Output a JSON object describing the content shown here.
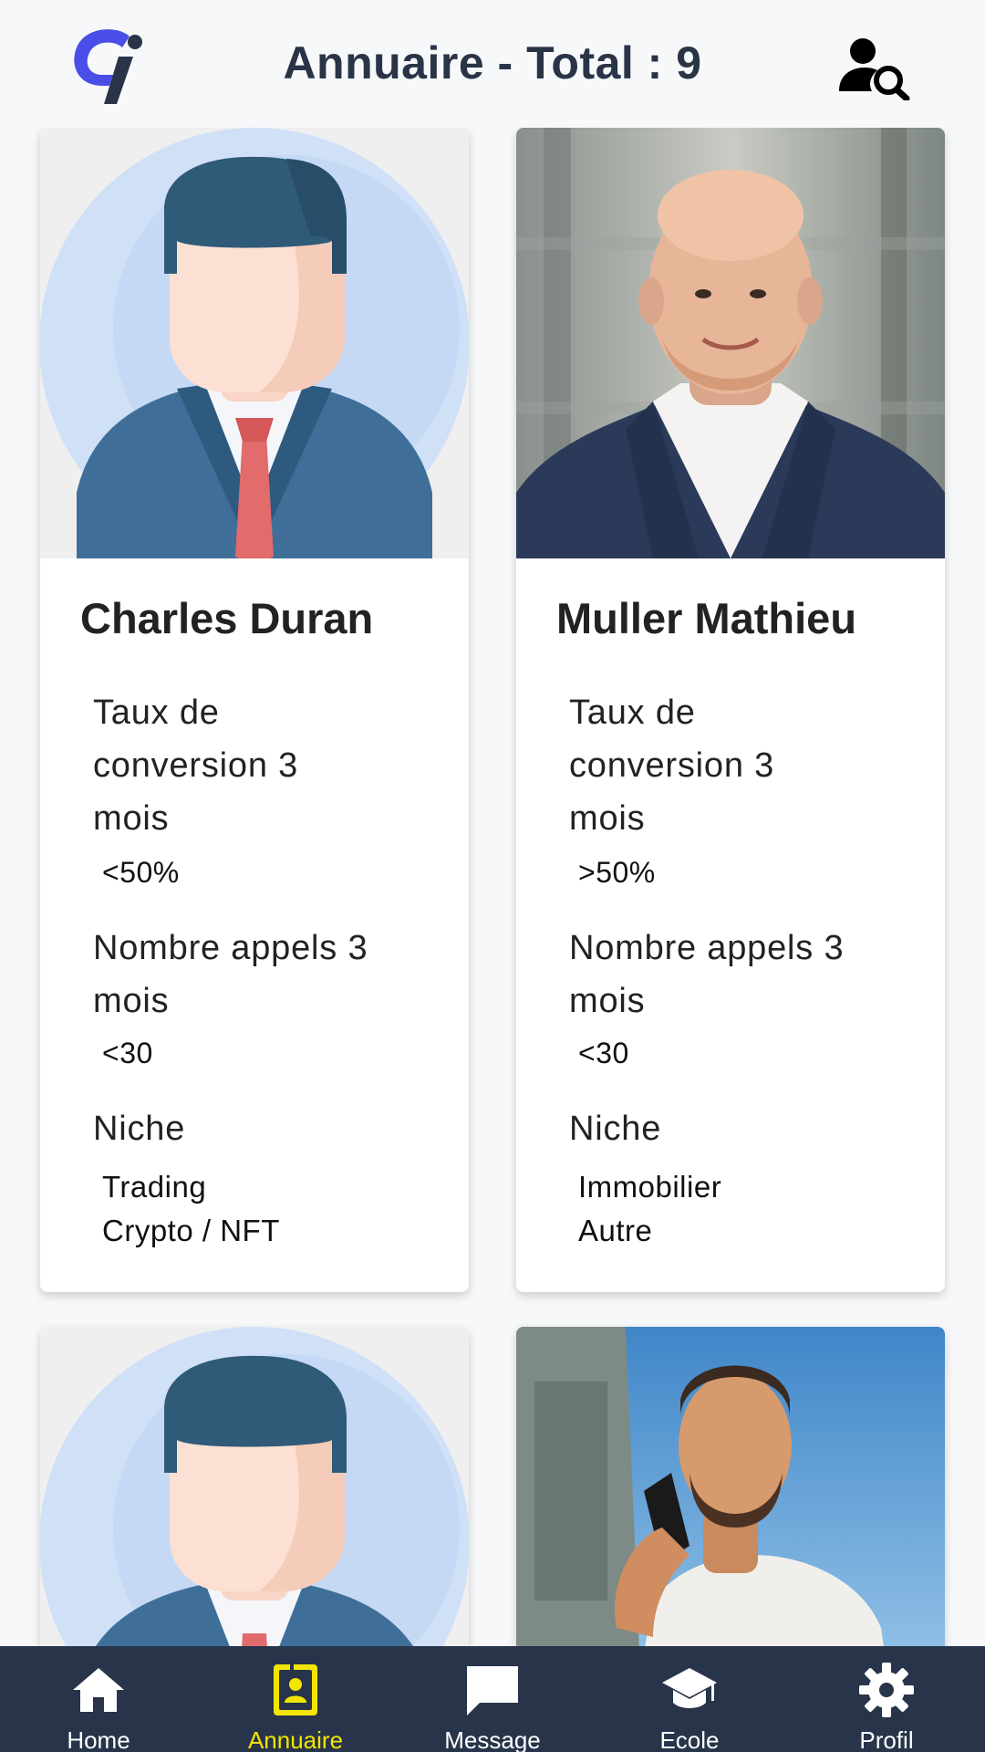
{
  "header": {
    "title": "Annuaire - Total : 9",
    "logo_icon": "app-logo",
    "search_icon": "user-search-icon"
  },
  "members": [
    {
      "name": "Charles Duran",
      "photo": "default-avatar",
      "conversion_label": "Taux de conversion 3 mois",
      "conversion_label_lines": [
        "Taux de",
        "conversion 3",
        "mois"
      ],
      "conversion_value": "<50%",
      "calls_label_lines": [
        "Nombre appels 3",
        "mois"
      ],
      "calls_value": "<30",
      "niche_label": "Niche",
      "niches": [
        "Trading",
        "Crypto / NFT"
      ]
    },
    {
      "name": "Muller Mathieu",
      "photo": "portrait-photo",
      "conversion_label_lines": [
        "Taux de",
        "conversion 3",
        "mois"
      ],
      "conversion_value": ">50%",
      "calls_label_lines": [
        "Nombre appels 3",
        "mois"
      ],
      "calls_value": "<30",
      "niche_label": "Niche",
      "niches": [
        "Immobilier",
        "Autre"
      ]
    },
    {
      "photo": "default-avatar"
    },
    {
      "photo": "portrait-photo"
    }
  ],
  "nav": [
    {
      "label": "Home",
      "icon": "home-icon",
      "active": false
    },
    {
      "label": "Annuaire",
      "icon": "directory-icon",
      "active": true
    },
    {
      "label": "Message",
      "icon": "message-icon",
      "active": false
    },
    {
      "label": "Ecole",
      "icon": "school-icon",
      "active": false
    },
    {
      "label": "Profil",
      "icon": "settings-icon",
      "active": false
    }
  ],
  "colors": {
    "nav_bg": "#27344a",
    "nav_active": "#f2e600",
    "title": "#2a3447",
    "avatar_bg": "#cfe0f7"
  }
}
